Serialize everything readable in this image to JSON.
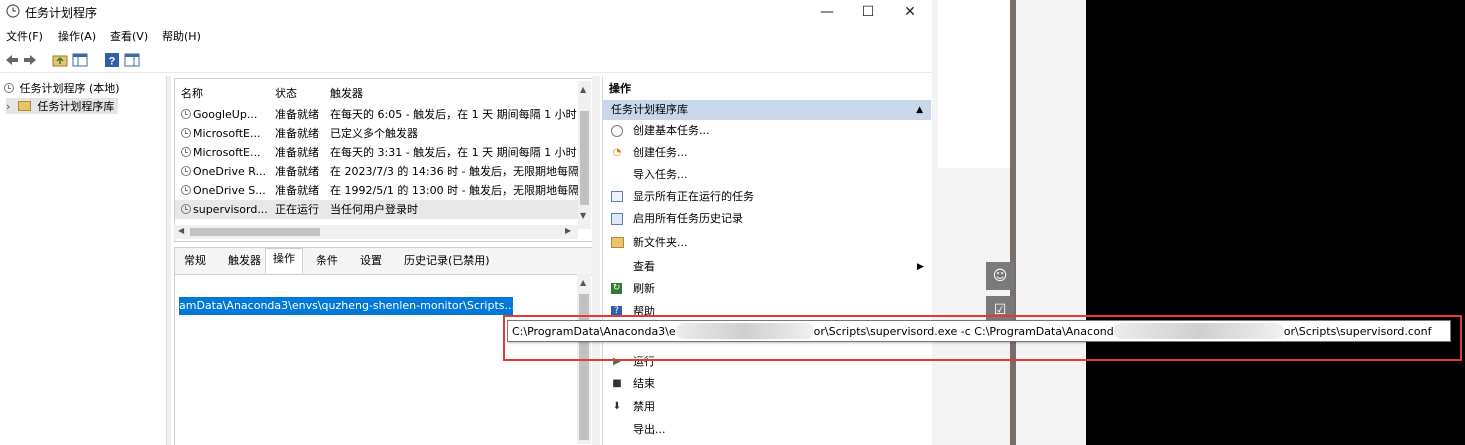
{
  "window": {
    "title": "任务计划程序",
    "minimize": "—",
    "maximize": "☐",
    "close": "✕"
  },
  "menu": [
    "文件(F)",
    "操作(A)",
    "查看(V)",
    "帮助(H)"
  ],
  "tree": {
    "root": "任务计划程序 (本地)",
    "library": "任务计划程序库"
  },
  "tasks": {
    "columns": [
      "名称",
      "状态",
      "触发器"
    ],
    "rows": [
      {
        "name": "GoogleUp...",
        "status": "准备就绪",
        "trigger": "在每天的 6:05 - 触发后，在 1 天 期间每隔 1 小时"
      },
      {
        "name": "MicrosoftE...",
        "status": "准备就绪",
        "trigger": "已定义多个触发器"
      },
      {
        "name": "MicrosoftE...",
        "status": "准备就绪",
        "trigger": "在每天的 3:31 - 触发后，在 1 天 期间每隔 1 小时"
      },
      {
        "name": "OneDrive R...",
        "status": "准备就绪",
        "trigger": "在 2023/7/3 的 14:36 时 - 触发后，无限期地每隔"
      },
      {
        "name": "OneDrive S...",
        "status": "准备就绪",
        "trigger": "在 1992/5/1 的 13:00 时 - 触发后，无限期地每隔"
      },
      {
        "name": "supervisord...",
        "status": "正在运行",
        "trigger": "当任何用户登录时"
      }
    ]
  },
  "detail": {
    "tabs": [
      "常规",
      "触发器",
      "操作",
      "条件",
      "设置",
      "历史记录(已禁用)"
    ],
    "action_line": "amData\\Anaconda3\\envs\\quzheng-shenlen-monitor\\Scripts..."
  },
  "actions": {
    "header": "操作",
    "group": "任务计划程序库",
    "items": [
      {
        "label": "创建基本任务..."
      },
      {
        "label": "创建任务..."
      },
      {
        "label": "导入任务..."
      },
      {
        "label": "显示所有正在运行的任务"
      },
      {
        "label": "启用所有任务历史记录"
      },
      {
        "label": "新文件夹..."
      },
      {
        "label": "查看"
      },
      {
        "label": "刷新"
      },
      {
        "label": "帮助"
      },
      {
        "label": "运行"
      },
      {
        "label": "结束"
      },
      {
        "label": "禁用"
      },
      {
        "label": "导出..."
      }
    ]
  },
  "tooltip": {
    "part1": "C:\\ProgramData\\Anaconda3\\e",
    "part2": "or\\Scripts\\supervisord.exe -c C:\\ProgramData\\Anacond",
    "part3": "or\\Scripts\\supervisord.conf"
  },
  "colors": {
    "selection": "#0078d7",
    "group_header": "#c9d7ea",
    "highlight_box": "#e53935"
  }
}
